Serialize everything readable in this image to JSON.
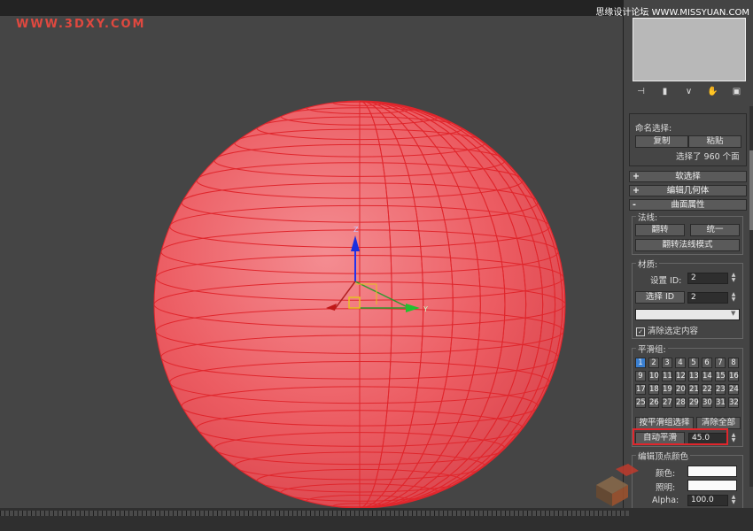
{
  "watermarks": {
    "top_left": "WWW.3DXY.COM",
    "top_right": "思缘设计论坛 WWW.MISSYUAN.COM"
  },
  "viewport": {
    "gizmo": {
      "z_label": "Z",
      "y_label": "Y"
    },
    "colors": {
      "background": "#454545",
      "sphere": "#ec5c62",
      "wire": "#e0262c"
    }
  },
  "panel": {
    "toolbar_icons": [
      "pin-icon",
      "pipe-icon",
      "vertex-icon",
      "hand-icon",
      "config-icon"
    ],
    "named_selection": {
      "title": "命名选择:",
      "copy": "复制",
      "paste": "粘贴",
      "status": "选择了 960 个面"
    },
    "rollouts": [
      {
        "sign": "+",
        "label": "软选择"
      },
      {
        "sign": "+",
        "label": "编辑几何体"
      },
      {
        "sign": "-",
        "label": "曲面属性"
      }
    ],
    "normals": {
      "title": "法线:",
      "flip": "翻转",
      "unify": "统一",
      "flip_mode": "翻转法线模式"
    },
    "material": {
      "title": "材质:",
      "set_id_label": "设置 ID:",
      "set_id_value": "2",
      "select_id_label": "选择 ID",
      "select_id_value": "2",
      "clear_label": "清除选定内容"
    },
    "smoothing": {
      "title": "平滑组:",
      "groups": [
        "1",
        "2",
        "3",
        "4",
        "5",
        "6",
        "7",
        "8",
        "9",
        "10",
        "11",
        "12",
        "13",
        "14",
        "15",
        "16",
        "17",
        "18",
        "19",
        "20",
        "21",
        "22",
        "23",
        "24",
        "25",
        "26",
        "27",
        "28",
        "29",
        "30",
        "31",
        "32"
      ],
      "active": [
        "1"
      ],
      "select_by": "按平滑组选择",
      "clear_all": "清除全部",
      "auto_smooth": "自动平滑",
      "auto_smooth_value": "45.0"
    },
    "vertex_colors": {
      "title": "编辑顶点颜色",
      "color_label": "颜色:",
      "illum_label": "照明:",
      "alpha_label": "Alpha:",
      "alpha_value": "100.0"
    }
  }
}
